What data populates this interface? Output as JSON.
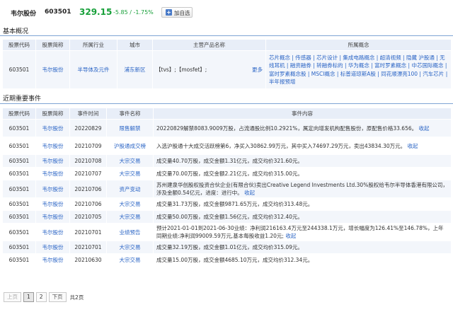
{
  "header": {
    "stock_name": "韦尔股份",
    "stock_code": "603501",
    "price": "329.15",
    "change": "-5.85 / -1.75%",
    "add_watchlist_label": "加自选"
  },
  "overview": {
    "section_title": "基本概况",
    "columns": [
      "股票代码",
      "股票简称",
      "所属行业",
      "城市",
      "主营产品名称",
      "所属概念"
    ],
    "row": {
      "code": "603501",
      "name": "韦尔股份",
      "industry": "半导体及元件",
      "city": "浦东新区",
      "products": "【tvs】;【mosfet】;",
      "more": "更多",
      "concepts": "芯片概念 | 传感器 | 芯片设计 | 集成电路概念 | 超清视频 | 隐藏 沪股通 | 无线耳机 | 融资融券 | 转融券标的 | 华为概念 | 富时罗素概念 | 中芯国际概念 | 富时罗素概念股 | MSCI概念 | 标普道琼斯A股 | 同花顺漂亮100 | 汽车芯片 | 半年报预增"
    }
  },
  "events": {
    "section_title": "近期重要事件",
    "columns": [
      "股票代码",
      "股票简称",
      "事件时间",
      "事件名称",
      "事件内容"
    ],
    "collapse_label": "收起",
    "rows": [
      {
        "code": "603501",
        "name": "韦尔股份",
        "date": "20220829",
        "event": "限售解禁",
        "content": "20220829解禁8083.9009万股，占流通股比例10.2921%，属定向增发机构配售股份，原配售价格33.656。",
        "collapse": "收起"
      },
      {
        "code": "603501",
        "name": "韦尔股份",
        "date": "20210709",
        "event": "沪股通成交榜",
        "content": "入选沪股通十大成交活跃榜第6，净买入30862.99万元，其中买入74697.29万元，卖出43834.30万元。",
        "collapse": "收起"
      },
      {
        "code": "603501",
        "name": "韦尔股份",
        "date": "20210708",
        "event": "大宗交易",
        "content": "成交量40.70万股，成交金额1.31亿元，成交均价321.60元。",
        "collapse": ""
      },
      {
        "code": "603501",
        "name": "韦尔股份",
        "date": "20210707",
        "event": "大宗交易",
        "content": "成交量70.00万股，成交金额2.21亿元，成交均价315.00元。",
        "collapse": ""
      },
      {
        "code": "603501",
        "name": "韦尔股份",
        "date": "20210706",
        "event": "资产变动",
        "content": "苏州建泉华创股权投资合伙企业(有限合伙)卖出Creative Legend Investments Ltd.30%股权给韦尔半导体香港有限公司，涉及金额0.54亿元，进度：进行中。",
        "collapse": "收起"
      },
      {
        "code": "603501",
        "name": "韦尔股份",
        "date": "20210706",
        "event": "大宗交易",
        "content": "成交量31.73万股，成交金额9871.65万元，成交均价313.48元。",
        "collapse": ""
      },
      {
        "code": "603501",
        "name": "韦尔股份",
        "date": "20210705",
        "event": "大宗交易",
        "content": "成交量50.00万股，成交金额1.56亿元，成交均价312.40元。",
        "collapse": ""
      },
      {
        "code": "603501",
        "name": "韦尔股份",
        "date": "20210701",
        "event": "业绩预告",
        "content": "预计2021-01-01到2021-06-30业绩：净利润216163.4万元至244338.1万元，增长幅度为126.41%至146.78%，上年同期业绩:净利润99009.59万元,基本每股收益1.20元;",
        "collapse": "收起"
      },
      {
        "code": "603501",
        "name": "韦尔股份",
        "date": "20210701",
        "event": "大宗交易",
        "content": "成交量32.19万股，成交金额1.01亿元，成交均价315.09元。",
        "collapse": ""
      },
      {
        "code": "603501",
        "name": "韦尔股份",
        "date": "20210630",
        "event": "大宗交易",
        "content": "成交量15.00万股，成交金额4685.10万元，成交均价312.34元。",
        "collapse": ""
      }
    ]
  },
  "pager": {
    "prev": "上页",
    "pages": [
      "1",
      "2"
    ],
    "current": "1",
    "next": "下页",
    "total": "共2页"
  },
  "colors": {
    "price_down": "#18a03a",
    "link": "#2a64c5",
    "header_bg": "#e8eef8",
    "rule": "#7fa5d4"
  }
}
